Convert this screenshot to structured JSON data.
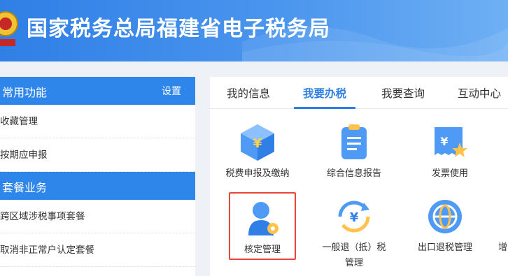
{
  "header": {
    "title": "国家税务总局福建省电子税务局"
  },
  "sidebar": {
    "common_title": "常用功能",
    "settings_label": "设置",
    "common_items": [
      {
        "label": "收藏管理"
      },
      {
        "label": "按期应申报"
      }
    ],
    "package_title": "套餐业务",
    "package_items": [
      {
        "label": "跨区域涉税事项套餐"
      },
      {
        "label": "取消非正常户认定套餐"
      }
    ]
  },
  "tabs": [
    {
      "label": "我的信息",
      "active": false
    },
    {
      "label": "我要办税",
      "active": true
    },
    {
      "label": "我要查询",
      "active": false
    },
    {
      "label": "互动中心",
      "active": false
    }
  ],
  "services": [
    {
      "label": "税费申报及缴纳",
      "icon": "tax-declaration-icon"
    },
    {
      "label": "综合信息报告",
      "icon": "report-icon"
    },
    {
      "label": "发票使用",
      "icon": "invoice-icon"
    },
    {
      "label": "核定管理",
      "icon": "verification-management-icon",
      "highlighted": true
    },
    {
      "label": "一般退（抵）税",
      "label_line2": "管理",
      "icon": "tax-refund-icon"
    },
    {
      "label": "出口退税管理",
      "icon": "export-refund-icon"
    },
    {
      "label": "增",
      "icon": "partial-icon"
    }
  ],
  "colors": {
    "accent": "#2f7fe6",
    "highlight_border": "#e8453c"
  }
}
